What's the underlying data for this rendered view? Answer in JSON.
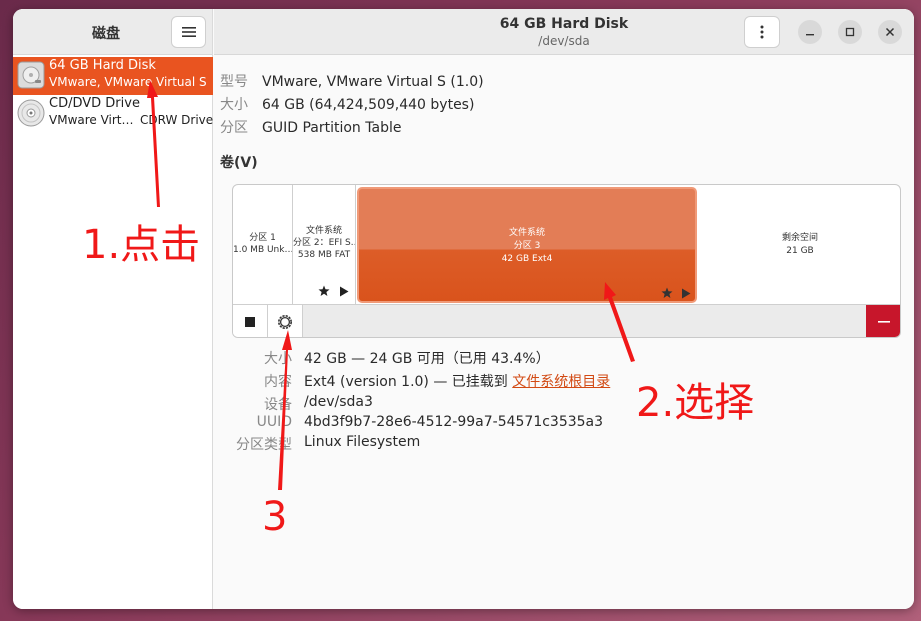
{
  "sidebar": {
    "title": "磁盘",
    "drives": [
      {
        "name": "64 GB Hard Disk",
        "subtitle": "VMware, VMware Virtual S",
        "selected": true,
        "icon": "hard-disk-icon"
      },
      {
        "name": "CD/DVD Drive",
        "subtitle": "VMware Virt…",
        "subtitle_right": "CDRW Drive",
        "selected": false,
        "icon": "optical-disc-icon"
      }
    ]
  },
  "header": {
    "title": "64 GB Hard Disk",
    "subtitle": "/dev/sda"
  },
  "disk_info": {
    "model_label": "型号",
    "model_value": "VMware, VMware Virtual S (1.0)",
    "size_label": "大小",
    "size_value": "64 GB (64,424,509,440 bytes)",
    "partition_label": "分区",
    "partition_value": "GUID Partition Table"
  },
  "volumes": {
    "section_title": "卷(V)",
    "partitions": [
      {
        "line1": "分区 1",
        "line2": "1.0 MB Unk…"
      },
      {
        "line1": "文件系统",
        "line2": "分区 2：EFI S…",
        "line3": "538 MB FAT"
      },
      {
        "line1": "文件系统",
        "line2": "分区 3",
        "line3": "42 GB Ext4"
      },
      {
        "line1": "剩余空间",
        "line2": "21 GB"
      }
    ]
  },
  "details": {
    "size_label": "大小",
    "size_value": "42 GB — 24 GB 可用（已用 43.4%）",
    "content_label": "内容",
    "content_value": "Ext4 (version 1.0) — 已挂载到 ",
    "content_link": "文件系统根目录",
    "device_label": "设备",
    "device_value": "/dev/sda3",
    "uuid_label": "UUID",
    "uuid_value": "4bd3f9b7-28e6-4512-99a7-54571c3535a3",
    "ptype_label": "分区类型",
    "ptype_value": "Linux Filesystem"
  },
  "annotations": {
    "step1": "1.点击",
    "step2": "2.选择",
    "step3": "3"
  },
  "colors": {
    "accent": "#e95420",
    "danger": "#c7162b",
    "annotation": "#f01818"
  }
}
